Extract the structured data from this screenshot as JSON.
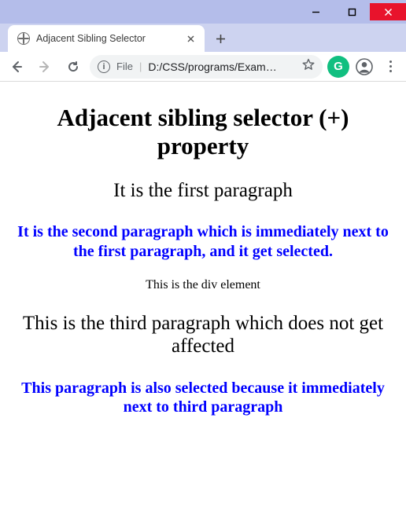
{
  "window": {
    "tab_title": "Adjacent Sibling Selector"
  },
  "toolbar": {
    "file_label": "File",
    "url": "D:/CSS/programs/Exam…",
    "extension_glyph": "G"
  },
  "content": {
    "heading": "Adjacent sibling selector (+) property",
    "p1": "It is the first paragraph",
    "p2": "It is the second paragraph which is immediately next to the first paragraph, and it get selected.",
    "div_text": "This is the div element",
    "p3": "This is the third paragraph which does not get affected",
    "p4": "This paragraph is also selected because it immediately next to third paragraph"
  }
}
